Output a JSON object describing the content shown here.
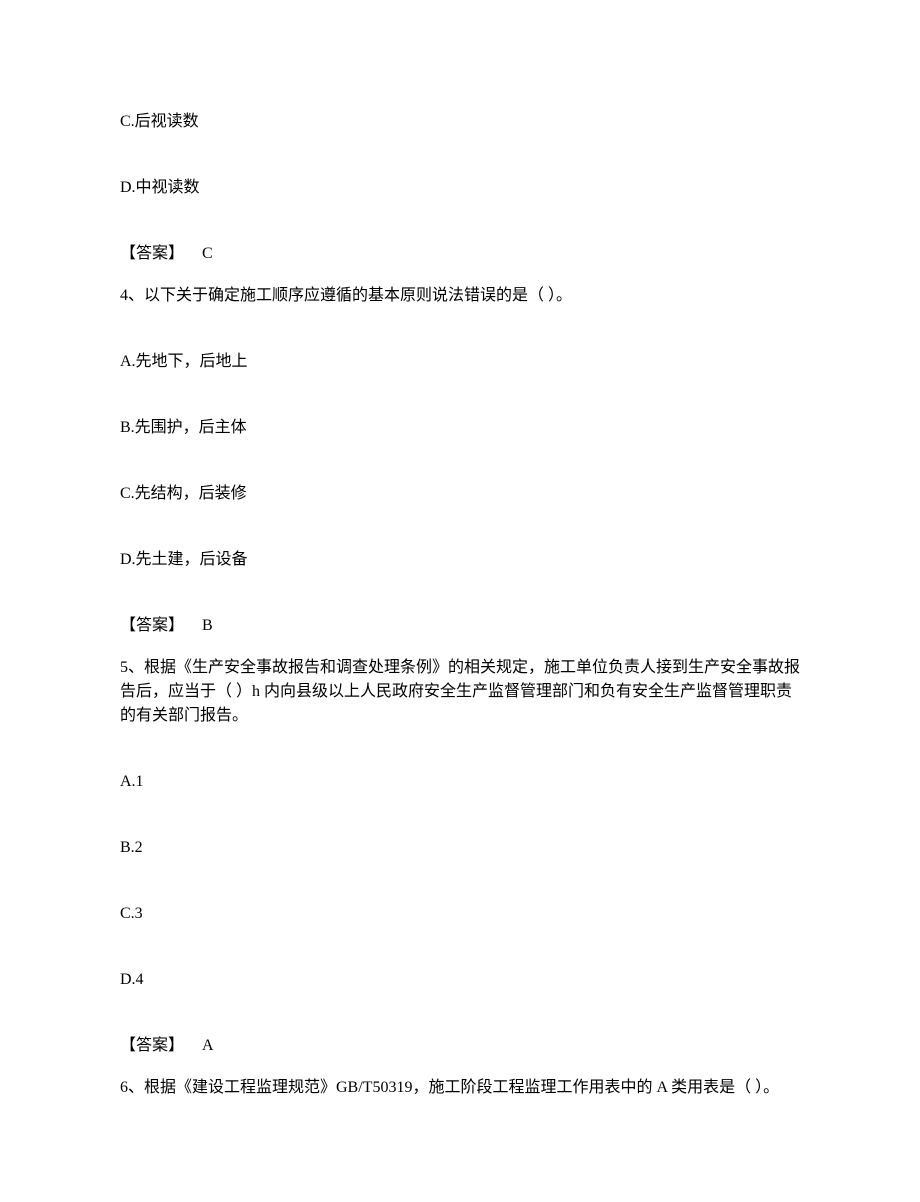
{
  "partial_options_top": {
    "c": "C.后视读数",
    "d": "D.中视读数"
  },
  "answer_label": "【答案】",
  "answer_prev": "C",
  "q4": {
    "stem": "4、以下关于确定施工顺序应遵循的基本原则说法错误的是（ ）。",
    "a": "A.先地下，后地上",
    "b": "B.先围护，后主体",
    "c": "C.先结构，后装修",
    "d": "D.先土建，后设备",
    "answer": "B"
  },
  "q5": {
    "stem": "5、根据《生产安全事故报告和调查处理条例》的相关规定，施工单位负责人接到生产安全事故报告后，应当于（ ）h 内向县级以上人民政府安全生产监督管理部门和负有安全生产监督管理职责的有关部门报告。",
    "a": "A.1",
    "b": "B.2",
    "c": "C.3",
    "d": "D.4",
    "answer": "A"
  },
  "q6": {
    "stem": "6、根据《建设工程监理规范》GB/T50319，施工阶段工程监理工作用表中的 A 类用表是（ ）。"
  }
}
